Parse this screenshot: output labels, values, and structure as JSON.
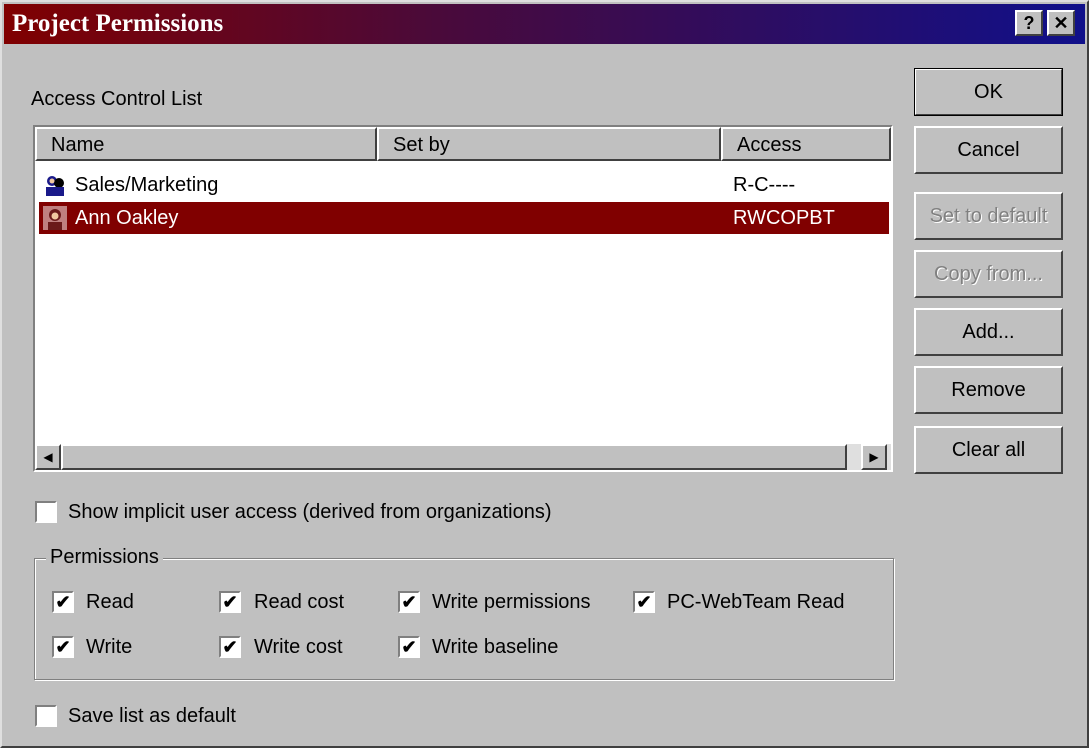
{
  "window": {
    "title": "Project Permissions",
    "help_label": "?",
    "close_label": "✕"
  },
  "acl": {
    "label": "Access Control List",
    "columns": [
      "Name",
      "Set by",
      "Access"
    ],
    "rows": [
      {
        "name": "Sales/Marketing",
        "set_by": "",
        "access": "R-C----",
        "icon": "group-icon",
        "selected": false
      },
      {
        "name": "Ann Oakley",
        "set_by": "",
        "access": "RWCOPBT",
        "icon": "user-icon",
        "selected": true
      }
    ]
  },
  "buttons": {
    "ok": "OK",
    "cancel": "Cancel",
    "set_default": "Set to default",
    "copy_from": "Copy from...",
    "add": "Add...",
    "remove": "Remove",
    "clear_all": "Clear all"
  },
  "show_implicit": {
    "label": "Show implicit user access (derived from organizations)",
    "checked": false
  },
  "permissions": {
    "legend": "Permissions",
    "read": {
      "label": "Read",
      "checked": true
    },
    "read_cost": {
      "label": "Read cost",
      "checked": true
    },
    "write_permissions": {
      "label": "Write  permissions",
      "checked": true
    },
    "pc_webteam_read": {
      "label": "PC-WebTeam Read",
      "checked": true
    },
    "write": {
      "label": "Write",
      "checked": true
    },
    "write_cost": {
      "label": "Write cost",
      "checked": true
    },
    "write_baseline": {
      "label": "Write baseline",
      "checked": true
    }
  },
  "save_default": {
    "label": "Save list as default",
    "checked": false
  },
  "check_glyph": "✔"
}
